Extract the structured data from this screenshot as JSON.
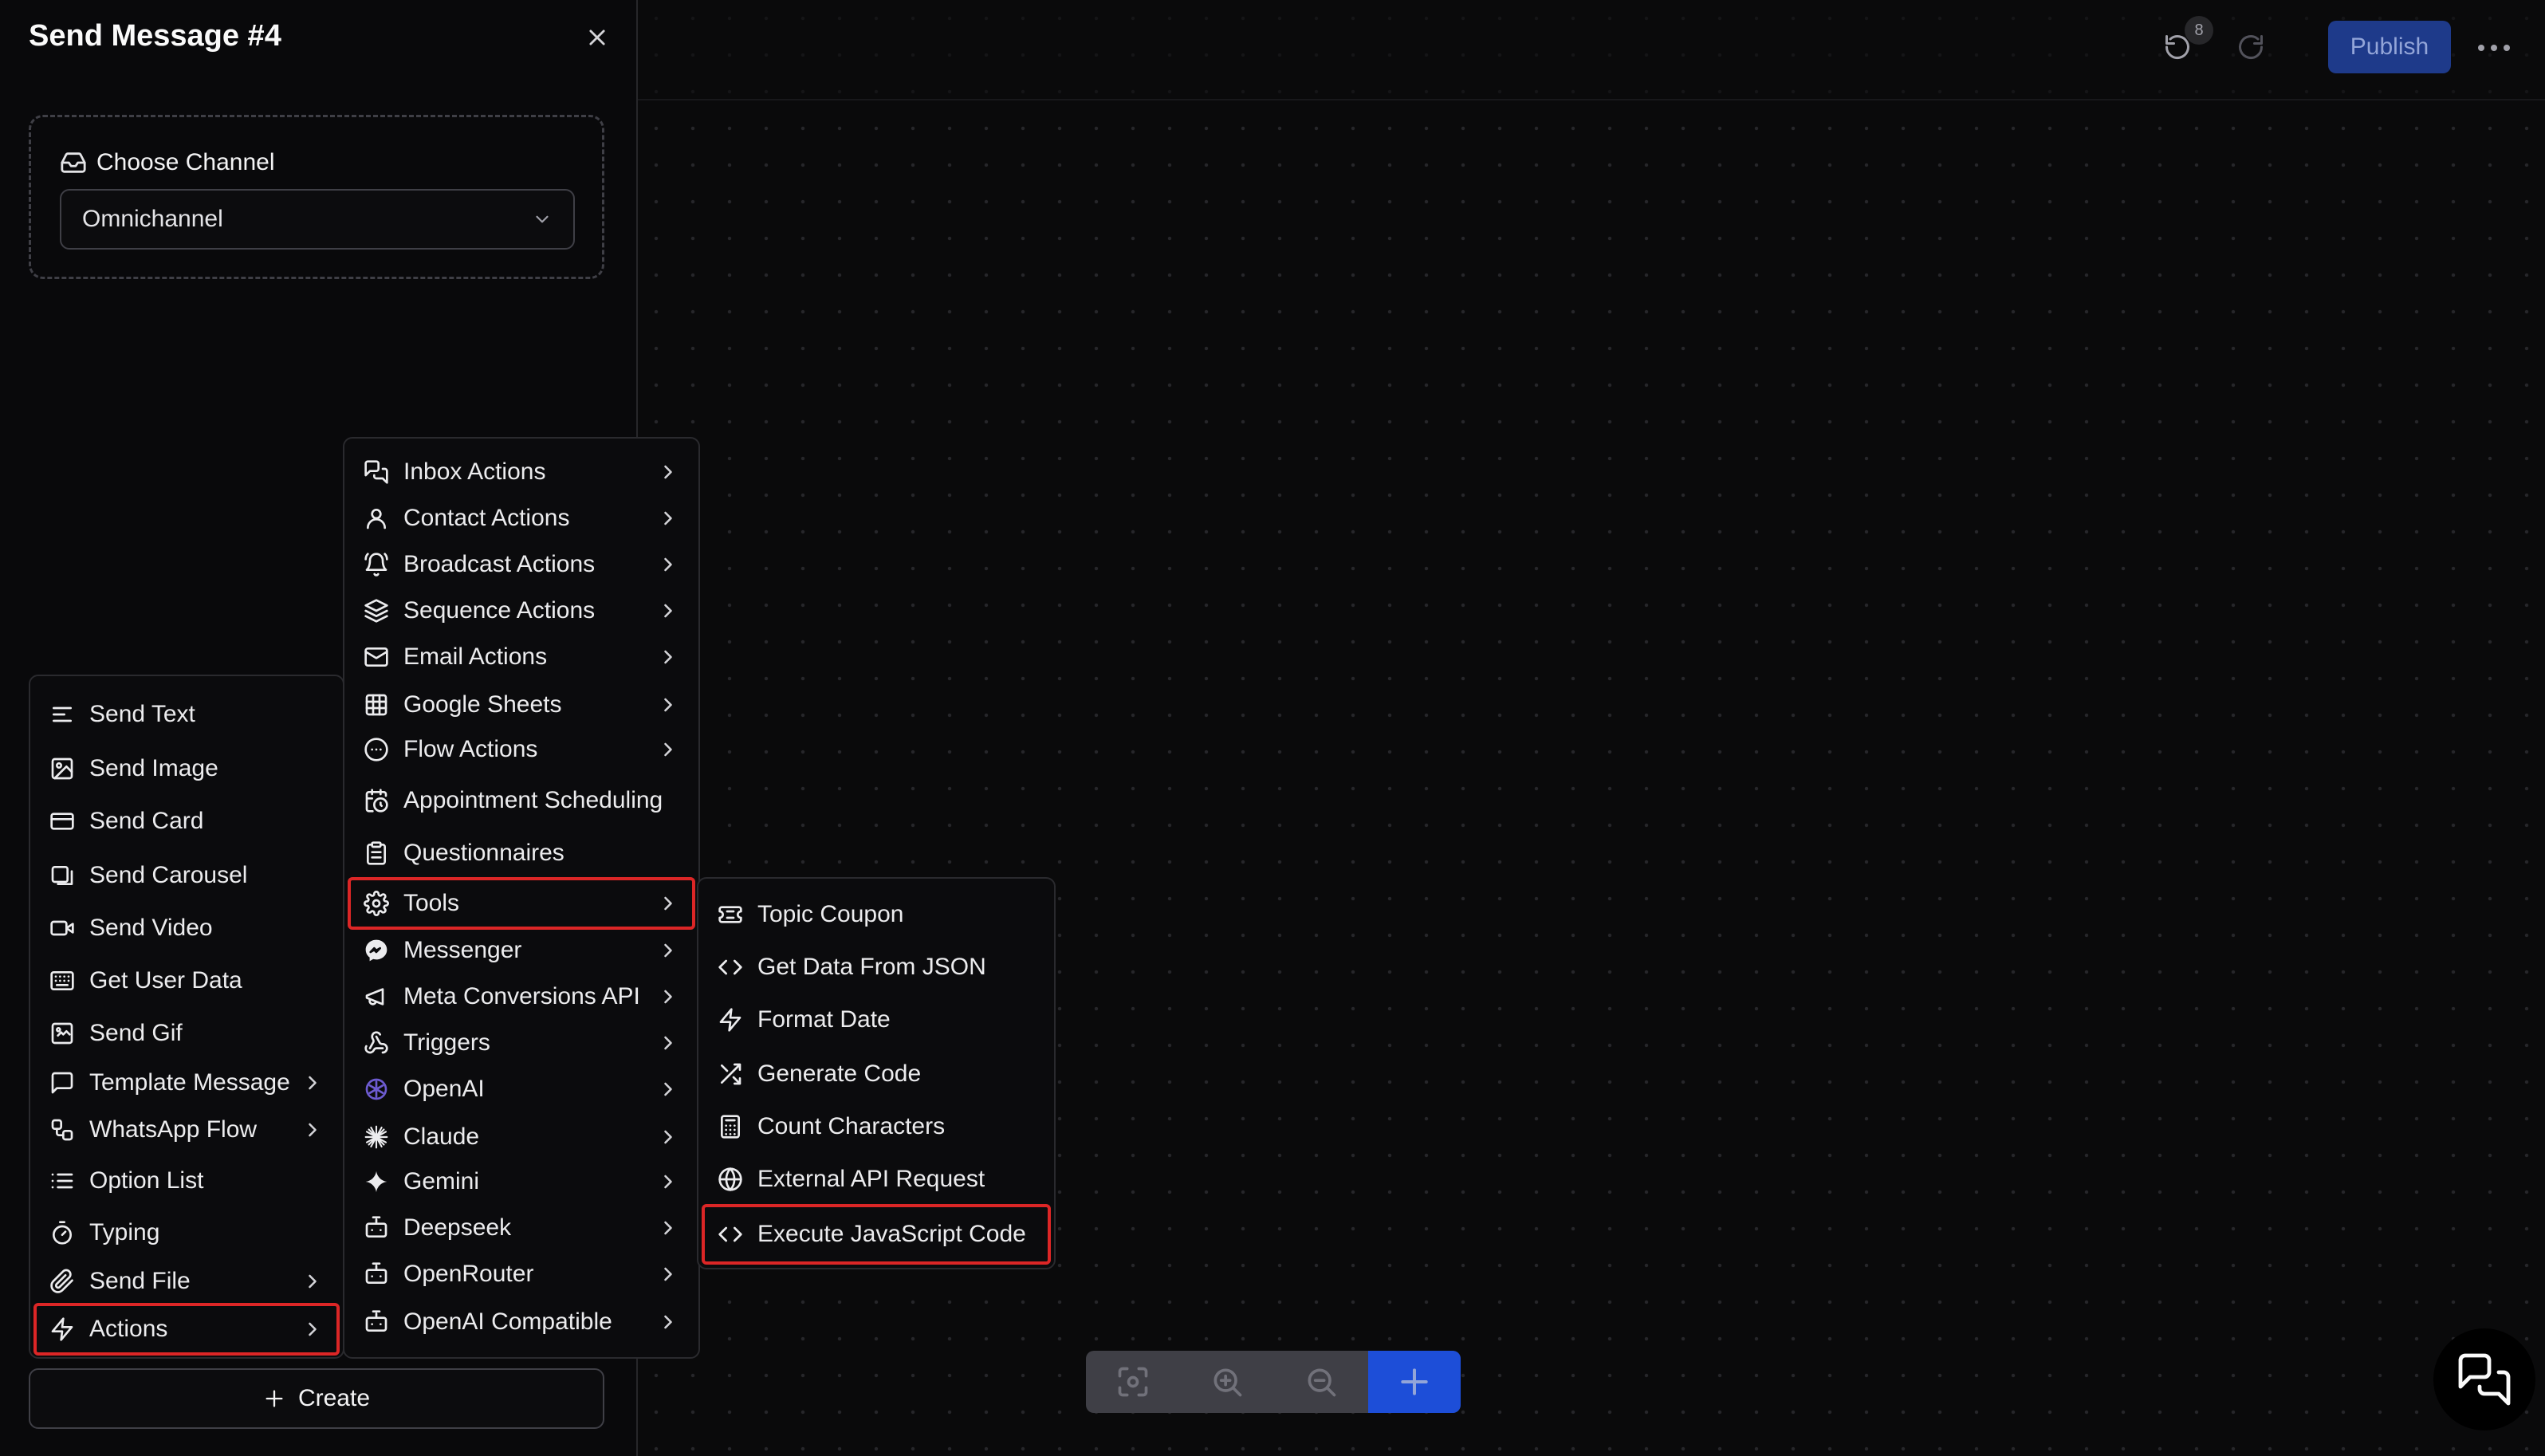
{
  "panel": {
    "title": "Send Message #4",
    "channel_label": "Choose Channel",
    "channel_value": "Omnichannel",
    "create_label": "Create"
  },
  "toolbar": {
    "undo_count": "8",
    "publish_label": "Publish"
  },
  "menu1": {
    "items": [
      {
        "label": "Send Text",
        "icon": "text-align-icon",
        "submenu": false
      },
      {
        "label": "Send Image",
        "icon": "image-icon",
        "submenu": false
      },
      {
        "label": "Send Card",
        "icon": "card-icon",
        "submenu": false
      },
      {
        "label": "Send Carousel",
        "icon": "carousel-icon",
        "submenu": false
      },
      {
        "label": "Send Video",
        "icon": "video-icon",
        "submenu": false
      },
      {
        "label": "Get User Data",
        "icon": "keyboard-icon",
        "submenu": false
      },
      {
        "label": "Send Gif",
        "icon": "gif-icon",
        "submenu": false
      },
      {
        "label": "Template Message",
        "icon": "message-square-icon",
        "submenu": true
      },
      {
        "label": "WhatsApp Flow",
        "icon": "workflow-icon",
        "submenu": true
      },
      {
        "label": "Option List",
        "icon": "list-icon",
        "submenu": false
      },
      {
        "label": "Typing",
        "icon": "timer-icon",
        "submenu": false
      },
      {
        "label": "Send File",
        "icon": "paperclip-icon",
        "submenu": true
      },
      {
        "label": "Actions",
        "icon": "lightning-icon",
        "submenu": true
      }
    ]
  },
  "menu2": {
    "items": [
      {
        "label": "Inbox Actions",
        "icon": "inbox-chat-icon",
        "submenu": true
      },
      {
        "label": "Contact Actions",
        "icon": "user-icon",
        "submenu": true
      },
      {
        "label": "Broadcast Actions",
        "icon": "bell-icon",
        "submenu": true
      },
      {
        "label": "Sequence Actions",
        "icon": "layers-icon",
        "submenu": true
      },
      {
        "label": "Email Actions",
        "icon": "mail-icon",
        "submenu": true
      },
      {
        "label": "Google Sheets",
        "icon": "table-icon",
        "submenu": true
      },
      {
        "label": "Flow Actions",
        "icon": "dots-circle-icon",
        "submenu": true
      },
      {
        "label": "Appointment Scheduling",
        "icon": "calendar-clock-icon",
        "submenu": false
      },
      {
        "label": "Questionnaires",
        "icon": "clipboard-icon",
        "submenu": false
      },
      {
        "label": "Tools",
        "icon": "gear-icon",
        "submenu": true
      },
      {
        "label": "Messenger",
        "icon": "messenger-icon",
        "submenu": true
      },
      {
        "label": "Meta Conversions API",
        "icon": "megaphone-icon",
        "submenu": true
      },
      {
        "label": "Triggers",
        "icon": "webhook-icon",
        "submenu": true
      },
      {
        "label": "OpenAI",
        "icon": "openai-icon",
        "submenu": true
      },
      {
        "label": "Claude",
        "icon": "claude-icon",
        "submenu": true
      },
      {
        "label": "Gemini",
        "icon": "gemini-icon",
        "submenu": true
      },
      {
        "label": "Deepseek",
        "icon": "bot-icon",
        "submenu": true
      },
      {
        "label": "OpenRouter",
        "icon": "bot-icon",
        "submenu": true
      },
      {
        "label": "OpenAI Compatible",
        "icon": "bot-icon",
        "submenu": true
      }
    ]
  },
  "menu3": {
    "items": [
      {
        "label": "Topic Coupon",
        "icon": "ticket-icon"
      },
      {
        "label": "Get Data From JSON",
        "icon": "code-icon"
      },
      {
        "label": "Format Date",
        "icon": "lightning-icon"
      },
      {
        "label": "Generate Code",
        "icon": "shuffle-icon"
      },
      {
        "label": "Count Characters",
        "icon": "calculator-icon"
      },
      {
        "label": "External API Request",
        "icon": "globe-icon"
      },
      {
        "label": "Execute JavaScript Code",
        "icon": "code-icon"
      }
    ]
  },
  "colors": {
    "highlight": "#dc2626",
    "publish_bg": "#1e3a8a",
    "zoom_add_bg": "#1d4ed8"
  }
}
